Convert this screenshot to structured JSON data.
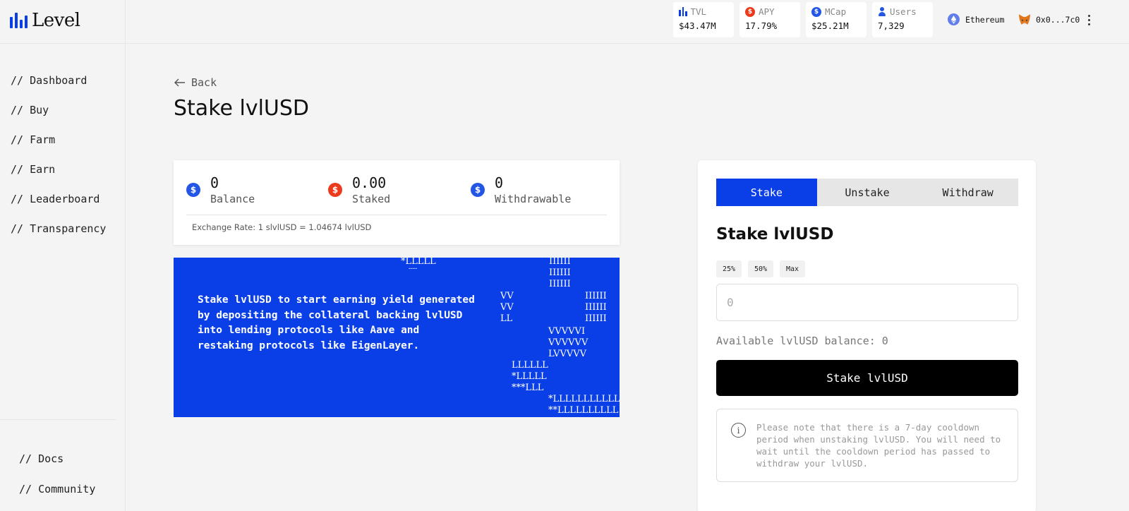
{
  "brand": {
    "name": "Level"
  },
  "sidebar": {
    "items": [
      {
        "label": "// Dashboard"
      },
      {
        "label": "// Buy"
      },
      {
        "label": "// Farm"
      },
      {
        "label": "// Earn"
      },
      {
        "label": "// Leaderboard"
      },
      {
        "label": "// Transparency"
      }
    ],
    "bottom_items": [
      {
        "label": "// Docs"
      },
      {
        "label": "// Community"
      }
    ]
  },
  "header": {
    "stats": [
      {
        "label": "TVL",
        "value": "$43.47M",
        "icon": "bars-icon"
      },
      {
        "label": "APY",
        "value": "17.79%",
        "icon": "dollar-coin-icon"
      },
      {
        "label": "MCap",
        "value": "$25.21M",
        "icon": "dollar-coin-icon"
      },
      {
        "label": "Users",
        "value": "7,329",
        "icon": "user-icon"
      }
    ],
    "network": "Ethereum",
    "wallet": "0x0...7c0"
  },
  "main": {
    "back_label": "Back",
    "title": "Stake lvlUSD",
    "balances": [
      {
        "value": "0",
        "label": "Balance"
      },
      {
        "value": "0.00",
        "label": "Staked"
      },
      {
        "value": "0",
        "label": "Withdrawable"
      }
    ],
    "exchange_rate": "Exchange Rate: 1 slvlUSD = 1.04674 lvlUSD",
    "promo_text": "Stake lvlUSD to start earning yield generated by depositing the collateral backing lvlUSD into lending protocols like Aave and restaking protocols like EigenLayer.",
    "art": {
      "line1": "*LLLLL",
      "line2": "----",
      "col_i_1": "IIIIII\nIIIIII\nIIIIII",
      "col_v_1": "VV\nVV\nLL",
      "col_i_2": "IIIIII\nIIIIII\nIIIIII",
      "col_v_2": "VVVVVI\nVVVVVV\nLVVVVV",
      "col_l_1": "LLLLLL\n*LLLLL\n***LLL",
      "col_l_2": "*LLLLLLLLLLL\n**LLLLLLLLLL"
    }
  },
  "form": {
    "tabs": [
      {
        "label": "Stake",
        "active": true
      },
      {
        "label": "Unstake",
        "active": false
      },
      {
        "label": "Withdraw",
        "active": false
      }
    ],
    "title": "Stake lvlUSD",
    "percent_buttons": [
      "25%",
      "50%",
      "Max"
    ],
    "amount_placeholder": "0",
    "available": "Available lvlUSD balance: 0",
    "submit_label": "Stake lvlUSD",
    "note": "Please note that there is a 7-day cooldown period when unstaking lvlUSD. You will need to wait until the cooldown period has passed to withdraw your lvlUSD."
  },
  "colors": {
    "accent": "#0a3fe8",
    "coin_red": "#ec3b1c",
    "background": "#f4f4f4"
  }
}
